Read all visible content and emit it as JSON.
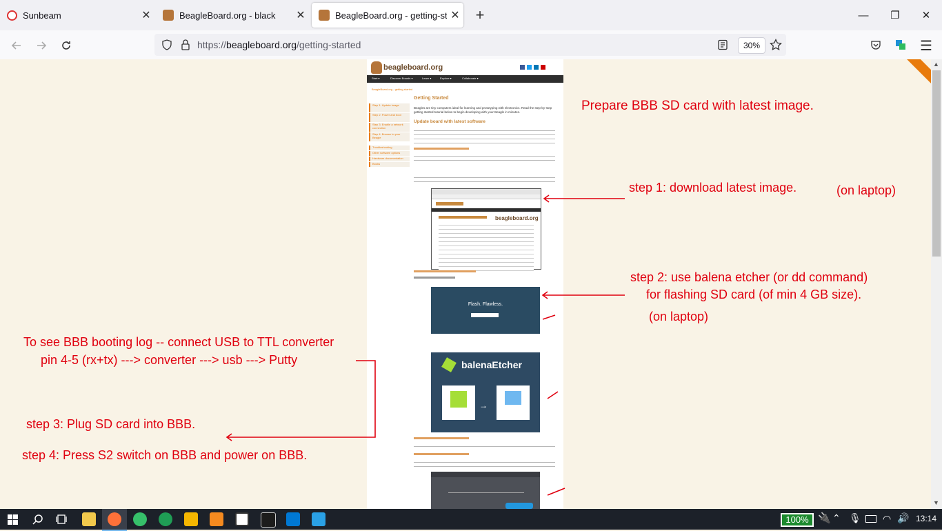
{
  "tabs": [
    {
      "label": "Sunbeam",
      "active": false
    },
    {
      "label": "BeagleBoard.org - black",
      "active": false
    },
    {
      "label": "BeagleBoard.org - getting-starte",
      "active": true
    }
  ],
  "new_tab_symbol": "+",
  "window_controls": {
    "minimize": "—",
    "maximize": "❐",
    "close": "✕"
  },
  "navbar": {
    "back_icon": "arrow-left-icon",
    "forward_icon": "arrow-right-icon",
    "reload_icon": "reload-icon",
    "url_prefix": "https://",
    "url_host": "beagleboard.org",
    "url_path": "/getting-started",
    "zoom": "30%"
  },
  "site": {
    "logo": "beagleboard.org",
    "menu": [
      "Start ▾",
      "Discover Boards ▾",
      "Learn ▾",
      "Explore ▾",
      "Collaborate ▾"
    ],
    "breadcrumb": "BeagleBoard.org - getting-started",
    "sidebar_steps": [
      "Step 1: Update image",
      "Step 2: Power and boot",
      "Step 3: Enable a network connection",
      "Step 4: Browse to your Beagle",
      "Troubleshooting",
      "Other software options",
      "Hardware documentation",
      "Books"
    ],
    "heading": "Getting Started",
    "intro": "Beagles are tiny computers ideal for learning and prototyping with electronics. Read the step-by-step getting started tutorial below to begin developing with your Beagle in minutes.",
    "subheading": "Update board with latest software",
    "etcher_brand": "balenaEtcher",
    "flash_title": "Flash. Flawless."
  },
  "annotations": {
    "prepare": "Prepare BBB SD card with latest image.",
    "step1": "step 1: download latest image.",
    "step1_note": "(on laptop)",
    "step2_line1": "step 2: use balena etcher (or dd command)",
    "step2_line2": "for flashing SD card (of min 4 GB size).",
    "step2_note": "(on laptop)",
    "log_line1": "To see BBB booting log -- connect USB to TTL converter",
    "log_line2": "pin 4-5 (rx+tx) ---> converter ---> usb ---> Putty",
    "step3": "step 3: Plug SD card into BBB.",
    "step4": "step 4: Press S2 switch on BBB and power on BBB."
  },
  "taskbar": {
    "battery": "100%",
    "time": "13:14"
  },
  "colors": {
    "annotation": "#e0000f",
    "page_bg": "#f9f3e6",
    "accent": "#e87b0d"
  }
}
